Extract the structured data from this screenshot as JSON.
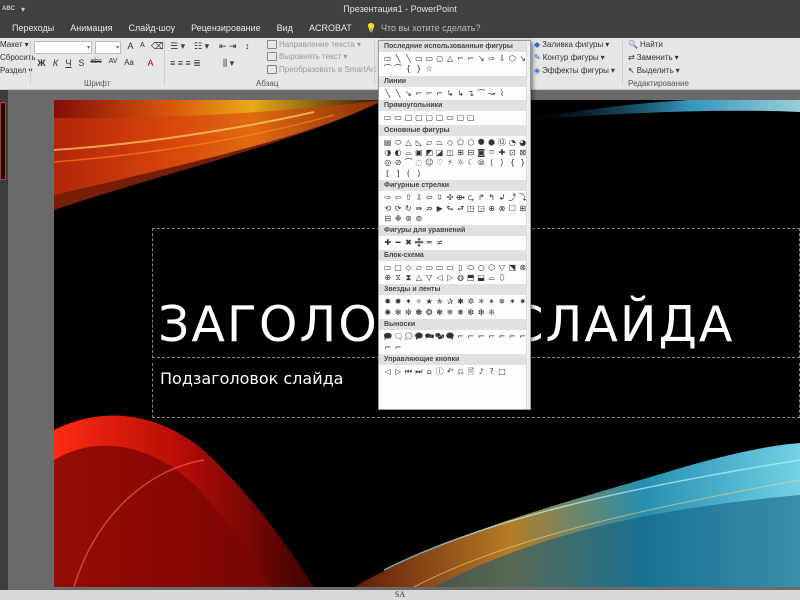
{
  "app": {
    "title": "Презентация1 - PowerPoint",
    "qat_glyph": "ABC"
  },
  "tabs": [
    "Переходы",
    "Анимация",
    "Слайд-шоу",
    "Рецензирование",
    "Вид",
    "ACROBAT"
  ],
  "tell_me": {
    "placeholder": "Что вы хотите сделать?"
  },
  "ribbon": {
    "slides": {
      "layout": "Макет",
      "reset": "Сбросить",
      "section": "Раздел"
    },
    "font_group": "Шрифт",
    "font_buttons": [
      "Ж",
      "К",
      "Ч",
      "S",
      "abc",
      "AV",
      "Aa",
      "A"
    ],
    "paragraph_group": "Абзац",
    "text_direction": "Направление текста",
    "align_text": "Выровнять текст",
    "smartart": "Преобразовать в SmartArt",
    "drawing": {
      "fill": "Заливка фигуры",
      "outline": "Контур фигуры",
      "effects": "Эффекты фигуры"
    },
    "editing": {
      "find": "Найти",
      "replace": "Заменить",
      "select": "Выделить",
      "group": "Редактирование"
    }
  },
  "slide": {
    "title": "ЗАГОЛОВОК СЛАЙДА",
    "subtitle": "Подзаголовок слайда"
  },
  "status": {
    "text": "SA"
  },
  "gallery": {
    "sections": [
      {
        "name": "Последние использованные фигуры",
        "shapes": [
          "▭",
          "╲",
          "╲",
          "▭",
          "▭",
          "○",
          "△",
          "⌐",
          "⌐",
          "↘",
          "⇨",
          "⇩",
          "⬡",
          "↘",
          "⌒",
          "⌒",
          "{",
          "}",
          "☆"
        ]
      },
      {
        "name": "Линии",
        "shapes": [
          "╲",
          "╲",
          "↘",
          "⌐",
          "⌐",
          "⌐",
          "↳",
          "↳",
          "↴",
          "⌒",
          "↝",
          "⌇"
        ]
      },
      {
        "name": "Прямоугольники",
        "shapes": [
          "▭",
          "▭",
          "▢",
          "▢",
          "▢",
          "▢",
          "▭",
          "▢",
          "▢"
        ]
      },
      {
        "name": "Основные фигуры",
        "shapes": [
          "▤",
          "⬭",
          "△",
          "◺",
          "▱",
          "⏢",
          "◇",
          "⬠",
          "⬡",
          "⯃",
          "⬢",
          "⑫",
          "◔",
          "◕",
          "◑",
          "◐",
          "⌓",
          "▣",
          "◩",
          "◪",
          "◫",
          "⊞",
          "⊟",
          "◙",
          "⌑",
          "✚",
          "⊡",
          "⊠",
          "◎",
          "⊘",
          "⌒",
          "◌",
          "☺",
          "♡",
          "⚡",
          "☼",
          "☾",
          "⦾",
          "⟨",
          "⟩",
          "{",
          "}",
          "[",
          "]",
          "(",
          ")"
        ]
      },
      {
        "name": "Фигурные стрелки",
        "shapes": [
          "⇨",
          "⇦",
          "⇧",
          "⇩",
          "⬄",
          "⇳",
          "✣",
          "⟴",
          "⮎",
          "↱",
          "↰",
          "↲",
          "⤴",
          "⤵",
          "⟲",
          "⟳",
          "↻",
          "⇛",
          "⇏",
          "▶",
          "⮑",
          "⮐",
          "◳",
          "◲",
          "⊕",
          "⊗",
          "☐",
          "⊞",
          "⊟",
          "✙",
          "⊛",
          "⊚"
        ]
      },
      {
        "name": "Фигуры для уравнений",
        "shapes": [
          "✚",
          "━",
          "✖",
          "➗",
          "═",
          "≠"
        ]
      },
      {
        "name": "Блок-схема",
        "shapes": [
          "▭",
          "▢",
          "◇",
          "▱",
          "▭",
          "▭",
          "▭",
          "▯",
          "⬭",
          "○",
          "⬡",
          "▽",
          "⬔",
          "⊗",
          "⊕",
          "⧖",
          "⧗",
          "△",
          "▽",
          "◁",
          "▷",
          "◍",
          "⬒",
          "⬓",
          "⌓",
          "⬯"
        ]
      },
      {
        "name": "Звезды и ленты",
        "shapes": [
          "✸",
          "✹",
          "✦",
          "✧",
          "★",
          "✯",
          "✰",
          "✱",
          "✲",
          "✳",
          "✴",
          "✵",
          "✶",
          "✷",
          "✺",
          "✻",
          "✼",
          "✽",
          "❂",
          "❃",
          "❄",
          "❅",
          "❆",
          "❇",
          "❈"
        ]
      },
      {
        "name": "Выноски",
        "shapes": [
          "🗩",
          "🗨",
          "🗯",
          "🗭",
          "🗪",
          "🗫",
          "🗬",
          "⌐",
          "⌐",
          "⌐",
          "⌐",
          "⌐",
          "⌐",
          "⌐",
          "⌐",
          "⌐"
        ]
      },
      {
        "name": "Управляющие кнопки",
        "shapes": [
          "◁",
          "▷",
          "⏮",
          "⏭",
          "⌂",
          "ⓘ",
          "↶",
          "⎌",
          "🗎",
          "♪",
          "?",
          "□"
        ]
      }
    ]
  }
}
